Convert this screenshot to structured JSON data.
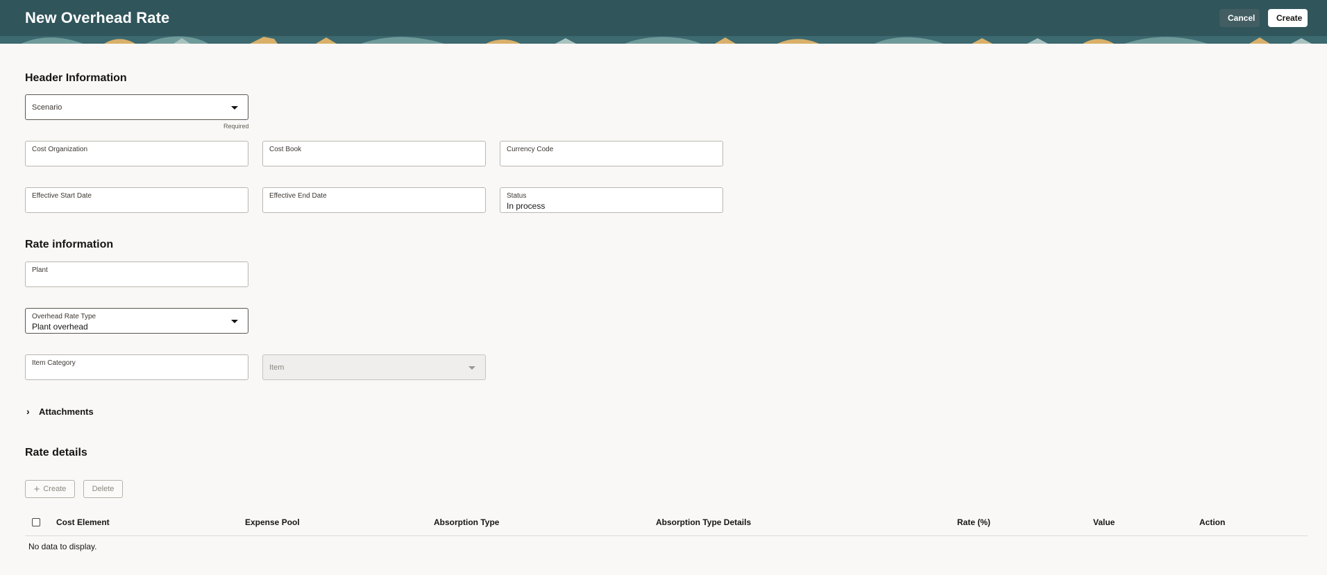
{
  "header": {
    "title": "New Overhead Rate",
    "cancel_label": "Cancel",
    "create_label": "Create"
  },
  "header_info": {
    "section_title": "Header Information",
    "scenario_placeholder": "Scenario",
    "required_label": "Required",
    "cost_org_label": "Cost Organization",
    "cost_book_label": "Cost Book",
    "currency_code_label": "Currency Code",
    "start_date_label": "Effective Start Date",
    "end_date_label": "Effective End Date",
    "status_label": "Status",
    "status_value": "In process"
  },
  "rate_info": {
    "section_title": "Rate information",
    "plant_label": "Plant",
    "overhead_type_label": "Overhead Rate Type",
    "overhead_type_value": "Plant overhead",
    "item_category_label": "Item Category",
    "item_placeholder": "Item"
  },
  "attachments": {
    "label": "Attachments",
    "chevron_icon": "chevron-right-icon"
  },
  "rate_details": {
    "section_title": "Rate details",
    "create_label": "Create",
    "delete_label": "Delete",
    "columns": [
      "Cost Element",
      "Expense Pool",
      "Absorption Type",
      "Absorption Type Details",
      "Rate (%)",
      "Value",
      "Action"
    ],
    "empty_text": "No data to display."
  },
  "colors": {
    "header_bg": "#30555b",
    "page_bg": "#f9f8f6"
  }
}
